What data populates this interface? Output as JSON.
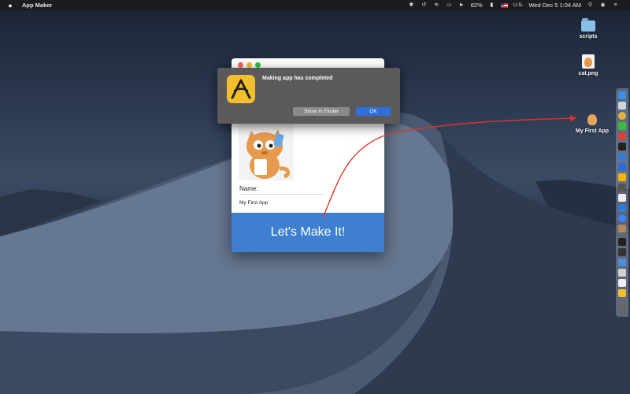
{
  "menubar": {
    "app_name": "App Maker",
    "input_source": "U.S.",
    "battery": "62%",
    "datetime": "Wed Dec 5  1:04 AM",
    "icons": [
      "apple-icon",
      "bluetooth-icon",
      "time-machine-icon",
      "wifi-icon",
      "airplay-icon",
      "volume-icon",
      "battery-icon",
      "flag-icon",
      "search-icon",
      "user-icon",
      "menu-icon"
    ]
  },
  "desktop": {
    "icons": [
      {
        "label": "scripts",
        "icon": "folder-icon"
      },
      {
        "label": "cat.png",
        "icon": "image-file-icon"
      },
      {
        "label": "My First App",
        "icon": "cat-app-icon"
      }
    ]
  },
  "window": {
    "name_label": "Name:",
    "name_value": "My First App",
    "make_button": "Let's Make It!"
  },
  "alert": {
    "message": "Making app has completed",
    "show_in_finder": "Show In Finder",
    "ok": "OK"
  },
  "colors": {
    "accent": "#3e7fd0",
    "ok_button": "#2f6fd8",
    "arrow": "#d9352b",
    "app_icon": "#f2c02e"
  }
}
